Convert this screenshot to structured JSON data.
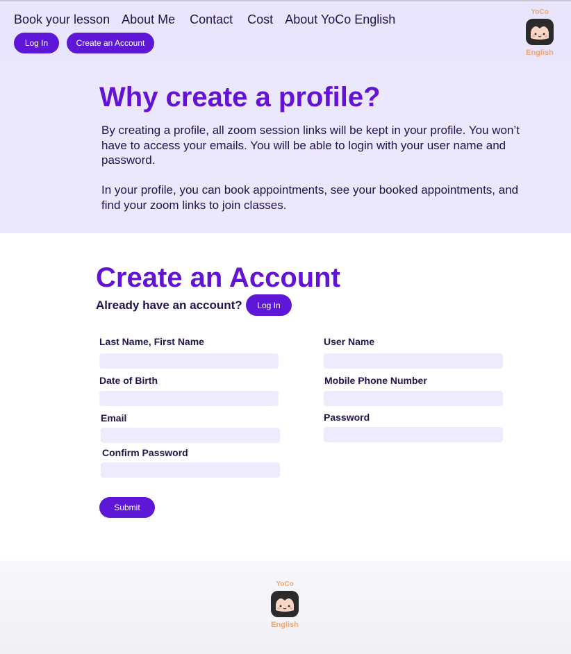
{
  "nav": {
    "items": [
      "Book your lesson",
      "About Me",
      "Contact",
      "Cost",
      "About YoCo English"
    ],
    "login_label": "Log In",
    "create_label": "Create an Account"
  },
  "logo": {
    "top": "YoCo",
    "bottom": "English"
  },
  "profile": {
    "title": "Why create a profile?",
    "p1": "By creating a profile, all zoom session links will be kept in your profile. You won’t have to access your emails. You will be able to login with your user name and password.",
    "p2": "In your profile, you can book appointments, see your booked appointments, and find your zoom links to join classes."
  },
  "account": {
    "title": "Create an Account",
    "already": "Already have an account?",
    "login_label": "Log In",
    "fields": {
      "name": "Last Name, First Name",
      "username": "User Name",
      "dob": "Date of Birth",
      "mobile": "Mobile Phone Number",
      "email": "Email",
      "password": "Password",
      "confirm": "Confirm Password"
    },
    "submit_label": "Submit"
  },
  "colors": {
    "accent": "#5e17d6",
    "heading": "#6313d3",
    "header_bg": "#e9e5fc",
    "field_bg": "#eeebfd",
    "logo_text": "#f2a46b"
  }
}
